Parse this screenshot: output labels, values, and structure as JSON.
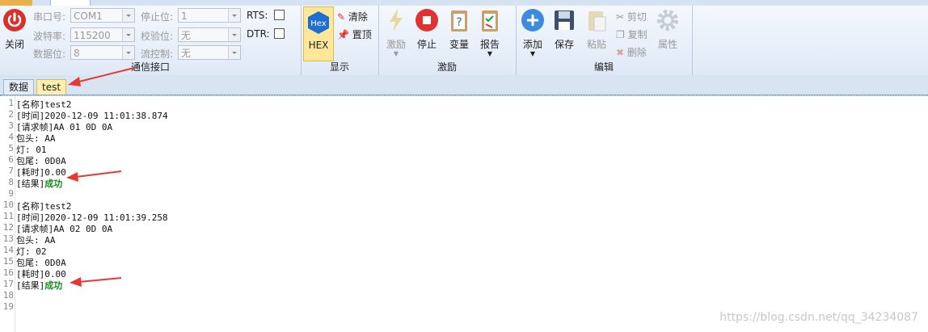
{
  "ribbon": {
    "close_label": "关闭",
    "serial": {
      "port_label": "串口号:",
      "port_value": "COM1",
      "baud_label": "波特率:",
      "baud_value": "115200",
      "databits_label": "数据位:",
      "databits_value": "8",
      "stopbits_label": "停止位:",
      "stopbits_value": "1",
      "parity_label": "校验位:",
      "parity_value": "无",
      "flow_label": "流控制:",
      "flow_value": "无",
      "rts_label": "RTS:",
      "dtr_label": "DTR:",
      "group_label": "通信接口"
    },
    "display": {
      "hex_icon": "Hex",
      "hex_label": "HEX",
      "clear_label": "清除",
      "pin_label": "置顶",
      "group_label": "显示"
    },
    "stimulus": {
      "stim_label": "激励",
      "stop_label": "停止",
      "var_label": "变量",
      "report_label": "报告",
      "group_label": "激励"
    },
    "edit": {
      "add_label": "添加",
      "save_label": "保存",
      "paste_label": "粘贴",
      "cut_label": "剪切",
      "copy_label": "复制",
      "delete_label": "删除",
      "props_label": "属性",
      "group_label": "编辑"
    }
  },
  "tabs": [
    {
      "label": "数据"
    },
    {
      "label": "test"
    }
  ],
  "editor": {
    "lines": [
      {
        "n": "1",
        "text": "[名称]test2"
      },
      {
        "n": "2",
        "text": "[时间]2020-12-09 11:01:38.874"
      },
      {
        "n": "3",
        "text": "[请求帧]AA 01 0D 0A"
      },
      {
        "n": "4",
        "text": "包头: AA"
      },
      {
        "n": "5",
        "text": "灯: 01"
      },
      {
        "n": "6",
        "text": "包尾: 0D0A"
      },
      {
        "n": "7",
        "text": "[耗时]0.00"
      },
      {
        "n": "8",
        "text": "[结果]",
        "ok": "成功"
      },
      {
        "n": "9",
        "text": ""
      },
      {
        "n": "10",
        "text": "[名称]test2"
      },
      {
        "n": "11",
        "text": "[时间]2020-12-09 11:01:39.258"
      },
      {
        "n": "12",
        "text": "[请求帧]AA 02 0D 0A"
      },
      {
        "n": "13",
        "text": "包头: AA"
      },
      {
        "n": "14",
        "text": "灯: 02"
      },
      {
        "n": "15",
        "text": "包尾: 0D0A"
      },
      {
        "n": "16",
        "text": "[耗时]0.00"
      },
      {
        "n": "17",
        "text": "[结果]",
        "ok": "成功"
      },
      {
        "n": "18",
        "text": ""
      },
      {
        "n": "19",
        "text": ""
      }
    ]
  },
  "watermark": "https://blog.csdn.net/qq_34234087",
  "colors": {
    "accent": "#e8b14a",
    "success": "#1a8a1a",
    "arrow": "#e53935"
  }
}
